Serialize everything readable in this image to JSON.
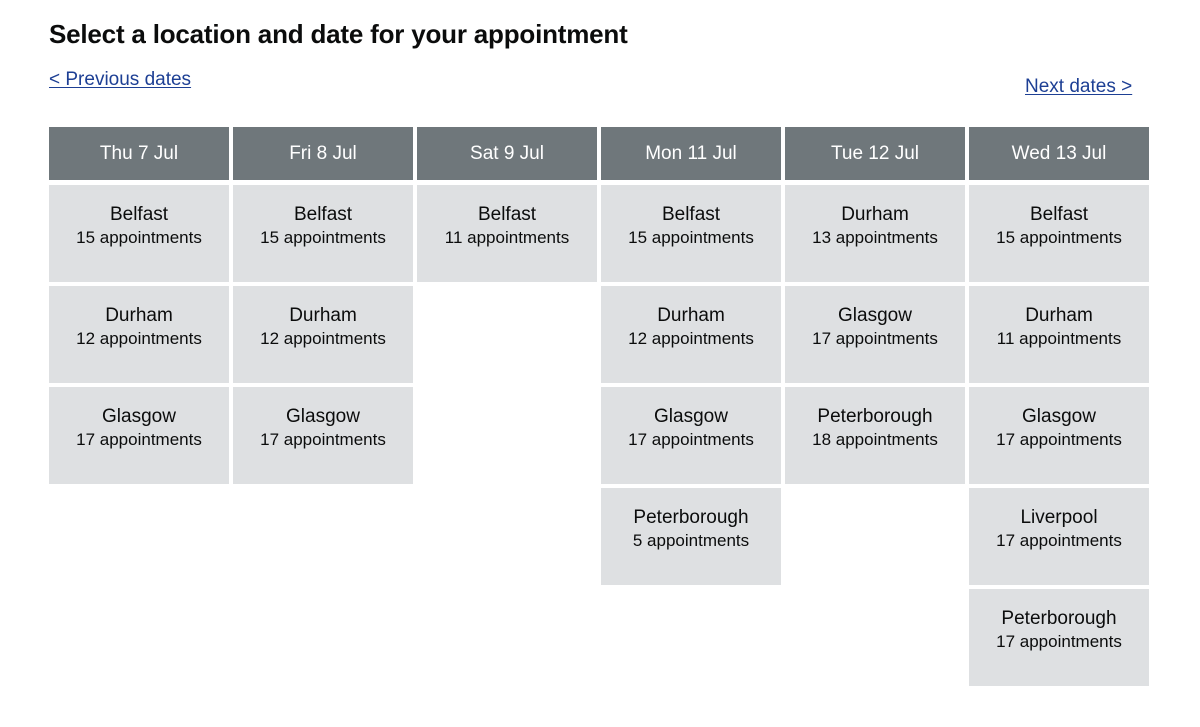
{
  "page": {
    "title": "Select a location and date for your appointment"
  },
  "navigation": {
    "previous_label": "< Previous dates",
    "next_label": "Next dates >"
  },
  "colors": {
    "header_background": "#6f777b",
    "header_text": "#ffffff",
    "slot_background": "#dee0e2",
    "slot_text": "#0b0c0c",
    "link": "#1d3f94",
    "page_background": "#ffffff"
  },
  "calendar": {
    "count_suffix": "appointments",
    "columns": [
      {
        "day": "Thu 7 Jul",
        "slots": [
          {
            "location": "Belfast",
            "count": "15 appointments"
          },
          {
            "location": "Durham",
            "count": "12 appointments"
          },
          {
            "location": "Glasgow",
            "count": "17 appointments"
          }
        ]
      },
      {
        "day": "Fri 8 Jul",
        "slots": [
          {
            "location": "Belfast",
            "count": "15 appointments"
          },
          {
            "location": "Durham",
            "count": "12 appointments"
          },
          {
            "location": "Glasgow",
            "count": "17 appointments"
          }
        ]
      },
      {
        "day": "Sat 9 Jul",
        "slots": [
          {
            "location": "Belfast",
            "count": "11 appointments"
          }
        ]
      },
      {
        "day": "Mon 11 Jul",
        "slots": [
          {
            "location": "Belfast",
            "count": "15 appointments"
          },
          {
            "location": "Durham",
            "count": "12 appointments"
          },
          {
            "location": "Glasgow",
            "count": "17 appointments"
          },
          {
            "location": "Peterborough",
            "count": "5 appointments"
          }
        ]
      },
      {
        "day": "Tue 12 Jul",
        "slots": [
          {
            "location": "Durham",
            "count": "13 appointments"
          },
          {
            "location": "Glasgow",
            "count": "17 appointments"
          },
          {
            "location": "Peterborough",
            "count": "18 appointments"
          }
        ]
      },
      {
        "day": "Wed 13 Jul",
        "slots": [
          {
            "location": "Belfast",
            "count": "15 appointments"
          },
          {
            "location": "Durham",
            "count": "11 appointments"
          },
          {
            "location": "Glasgow",
            "count": "17 appointments"
          },
          {
            "location": "Liverpool",
            "count": "17 appointments"
          },
          {
            "location": "Peterborough",
            "count": "17 appointments"
          }
        ]
      }
    ]
  }
}
